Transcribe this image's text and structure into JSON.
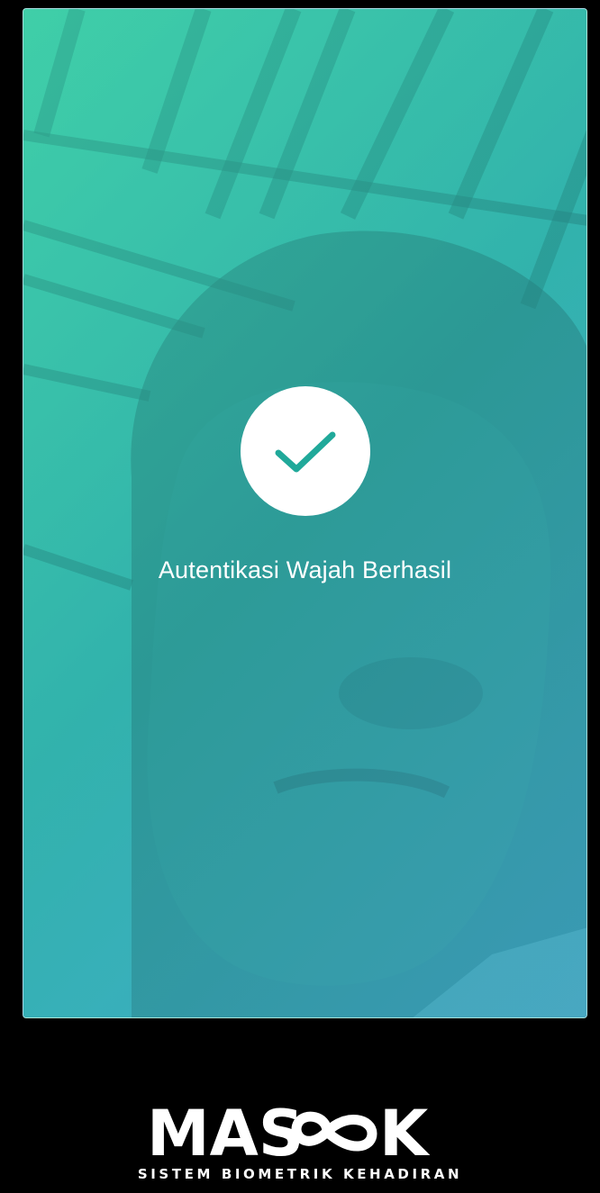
{
  "auth": {
    "status_message": "Autentikasi Wajah Berhasil",
    "status_icon": "checkmark-icon",
    "accent_color": "#20a99a"
  },
  "brand": {
    "logo_text": "MASOOK",
    "tagline": "SISTEM BIOMETRIK KEHADIRAN"
  }
}
